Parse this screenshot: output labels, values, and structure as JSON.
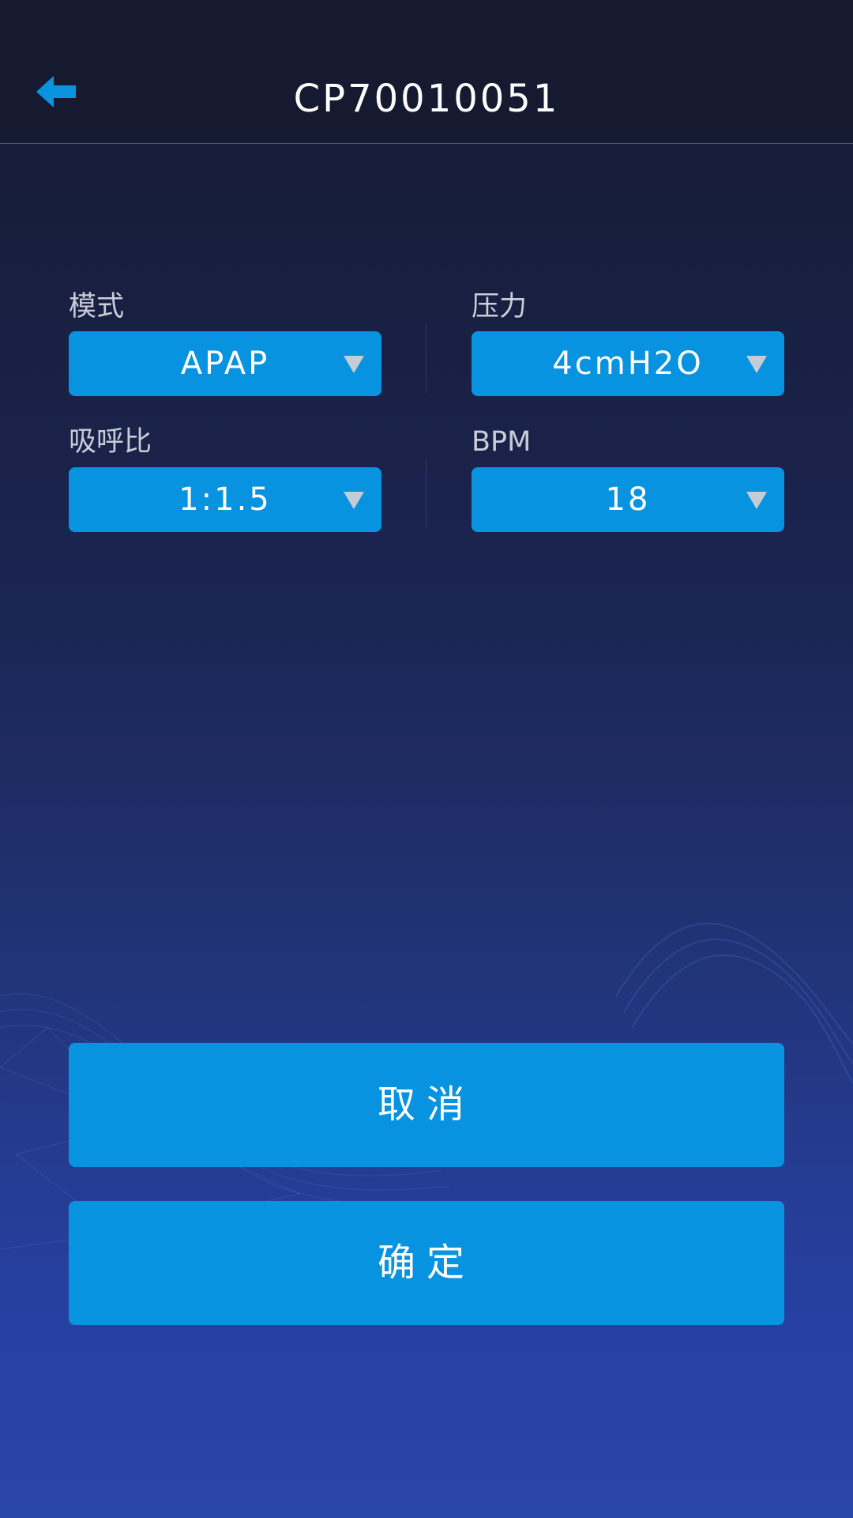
{
  "header": {
    "title": "CP70010051",
    "back_icon": "arrow-left-icon"
  },
  "settings": [
    {
      "key": "mode",
      "label": "模式",
      "value": "APAP"
    },
    {
      "key": "pressure",
      "label": "压力",
      "value": "4cmH2O"
    },
    {
      "key": "ie_ratio",
      "label": "吸呼比",
      "value": "1:1.5"
    },
    {
      "key": "bpm",
      "label": "BPM",
      "value": "18"
    }
  ],
  "actions": {
    "cancel_label": "取消",
    "confirm_label": "确定"
  },
  "colors": {
    "accent": "#0893e0",
    "header_bg": "#151a31",
    "bg_top": "#151a33",
    "bg_bottom": "#2a45a8",
    "label_text": "#c9cdd8"
  }
}
